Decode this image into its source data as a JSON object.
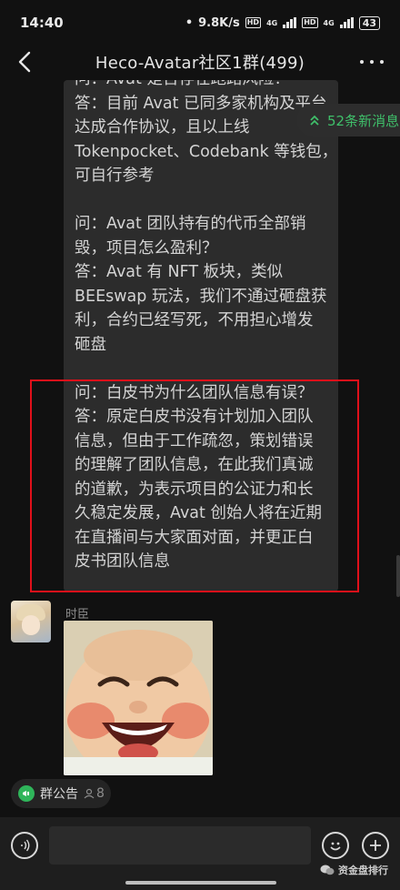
{
  "status_bar": {
    "time": "14:40",
    "net_speed": "9.8K/s",
    "network_a": "4G",
    "network_b": "4G",
    "battery": "43"
  },
  "header": {
    "title": "Heco-Avatar社区1群(499)"
  },
  "new_messages": {
    "label": "52条新消息",
    "accent": "#3fbf6a"
  },
  "chat": {
    "bubble_lines": [
      "问：Avat 是否存在跑路风险？",
      "答：目前 Avat 已同多家机构及平台",
      "达成合作协议，且以上线",
      "Tokenpocket、Codebank 等钱包，",
      "可自行参考",
      "",
      "问：Avat 团队持有的代币全部销",
      "毁，项目怎么盈利？",
      "答：Avat 有 NFT 板块，类似",
      "BEEswap 玩法，我们不通过砸盘获",
      "利，合约已经写死，不用担心增发",
      "砸盘",
      "",
      "问：白皮书为什么团队信息有误？",
      "答：原定白皮书没有计划加入团队",
      "信息，但由于工作疏忽，策划错误",
      "的理解了团队信息，在此我们真诚",
      "的道歉，为表示项目的公证力和长",
      "久稳定发展，Avat 创始人将在近期",
      "在直播间与大家面对面，并更正白",
      "皮书团队信息"
    ],
    "highlight_color": "#e0101a",
    "second_message": {
      "sender": "时臣"
    }
  },
  "notice": {
    "label": "群公告",
    "count": "8"
  },
  "watermark": {
    "text": "资金盘排行"
  }
}
